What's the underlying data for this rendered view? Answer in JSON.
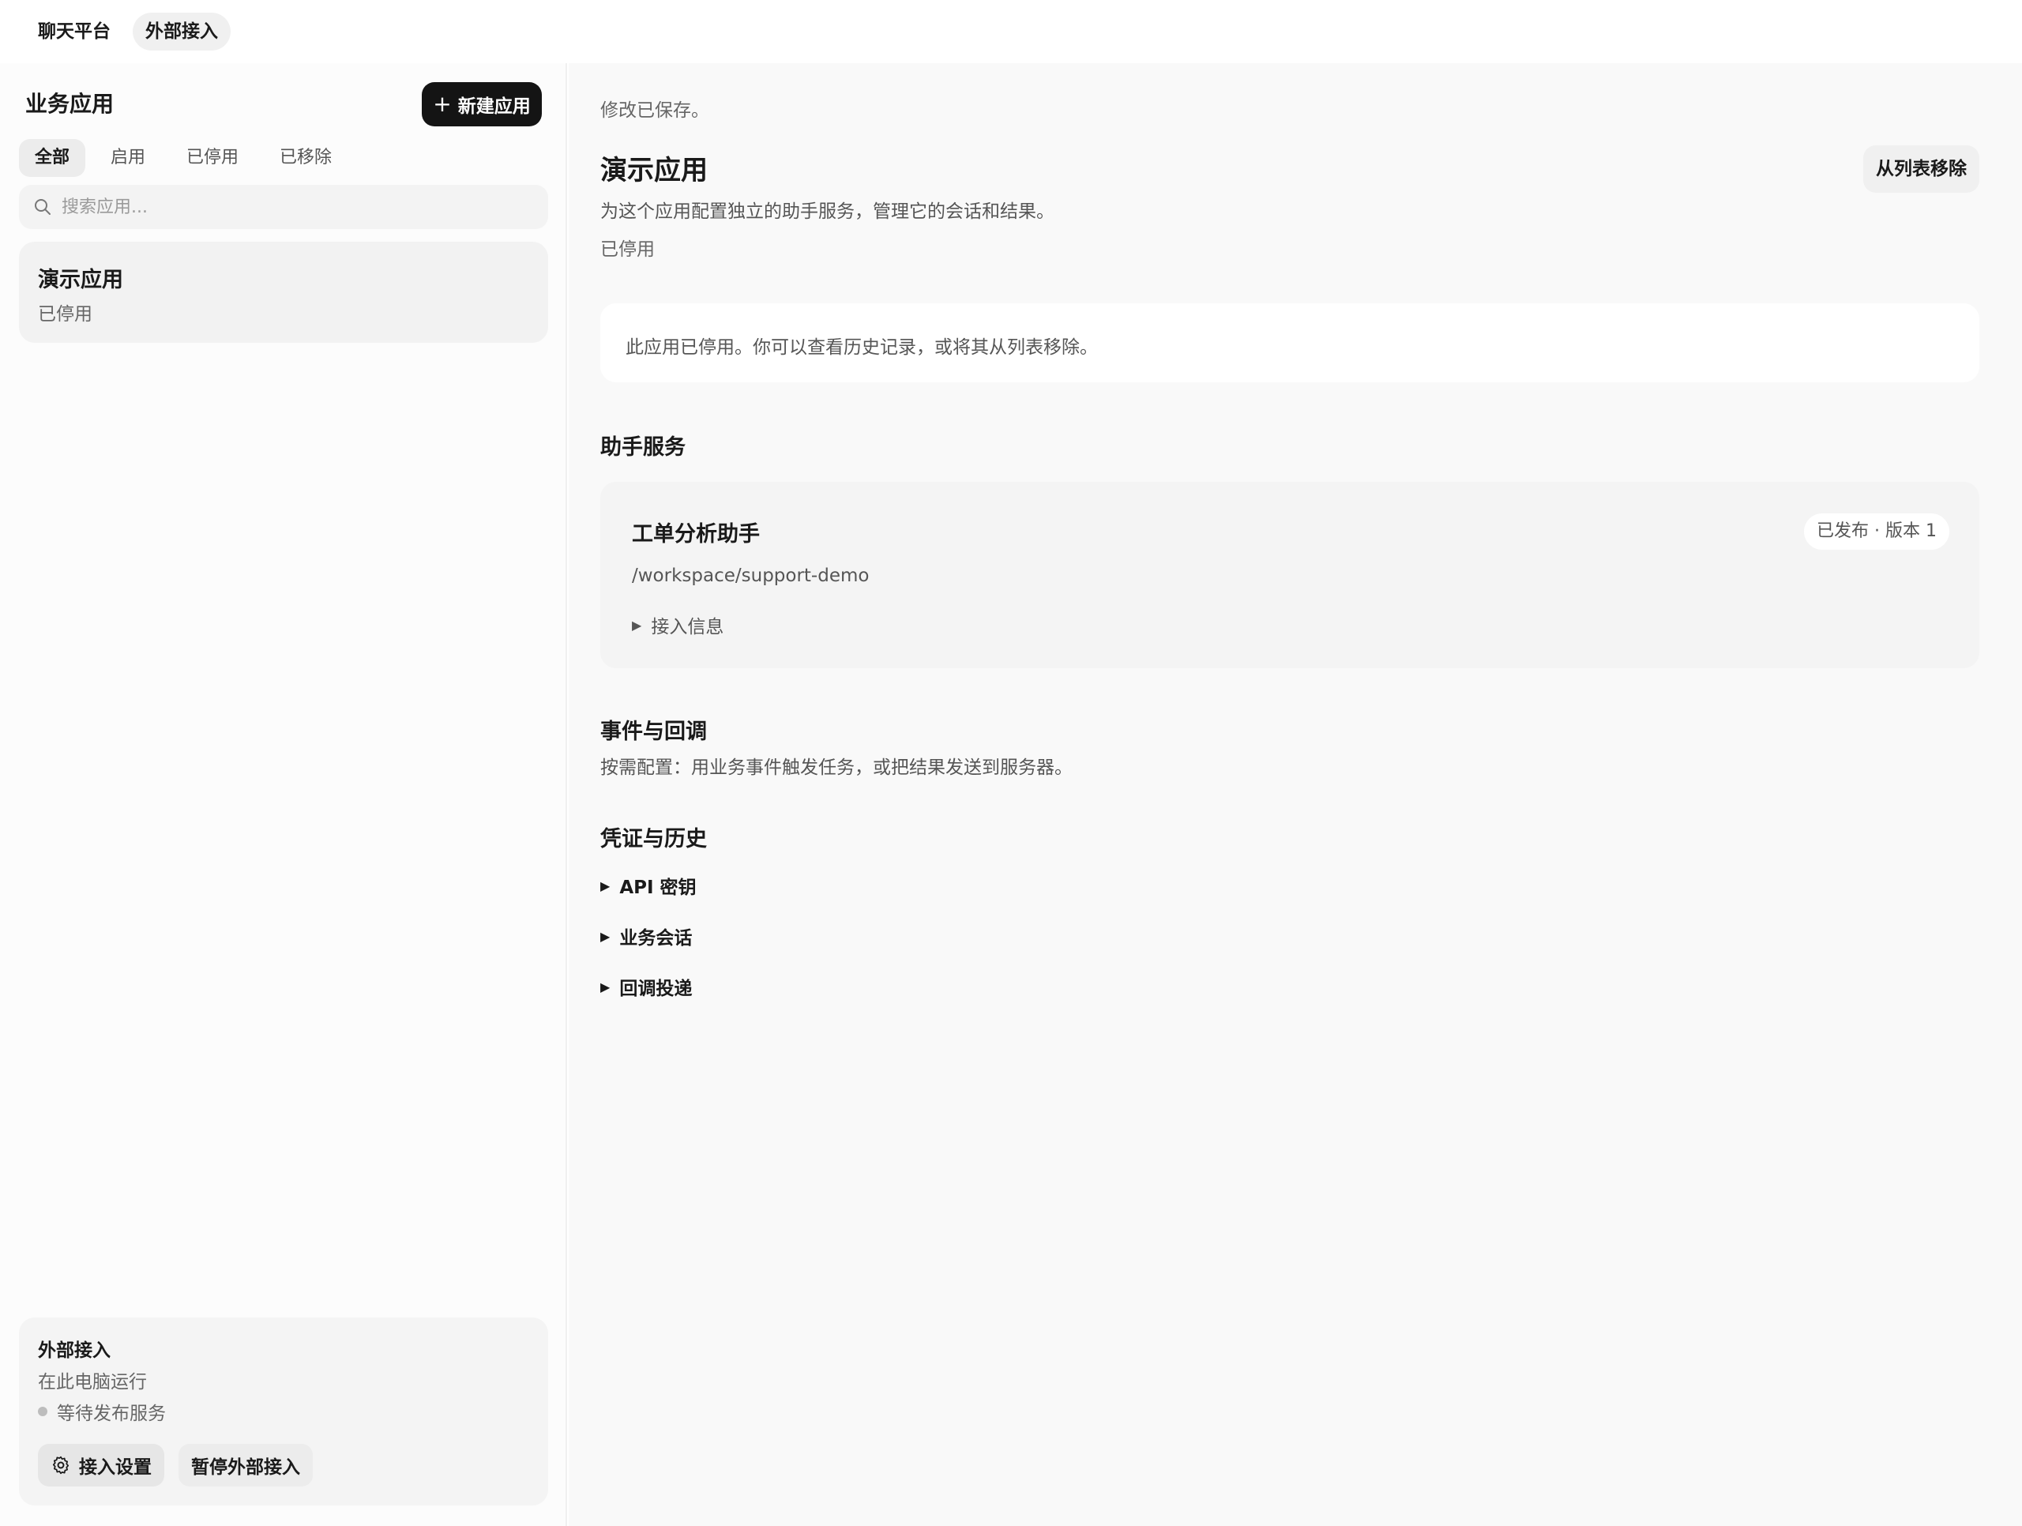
{
  "topbar": {
    "tab_chat": "聊天平台",
    "tab_external": "外部接入"
  },
  "sidebar": {
    "title": "业务应用",
    "new_app_label": "新建应用",
    "filters": [
      "全部",
      "启用",
      "已停用",
      "已移除"
    ],
    "search_placeholder": "搜索应用...",
    "app": {
      "name": "演示应用",
      "status": "已停用"
    },
    "external": {
      "title": "外部接入",
      "subtitle": "在此电脑运行",
      "waiting": "等待发布服务",
      "settings_label": "接入设置",
      "pause_label": "暂停外部接入"
    }
  },
  "main": {
    "saved_notice": "修改已保存。",
    "app_title": "演示应用",
    "remove_label": "从列表移除",
    "description": "为这个应用配置独立的助手服务，管理它的会话和结果。",
    "state": "已停用",
    "disabled_notice": "此应用已停用。你可以查看历史记录，或将其从列表移除。",
    "assistant_section": {
      "title": "助手服务",
      "service_name": "工单分析助手",
      "badge": "已发布 · 版本 1",
      "path": "/workspace/support-demo",
      "access_info": "接入信息"
    },
    "events_section": {
      "title": "事件与回调",
      "description": "按需配置：用业务事件触发任务，或把结果发送到服务器。"
    },
    "credentials_section": {
      "title": "凭证与历史",
      "items": [
        "API 密钥",
        "业务会话",
        "回调投递"
      ]
    }
  }
}
